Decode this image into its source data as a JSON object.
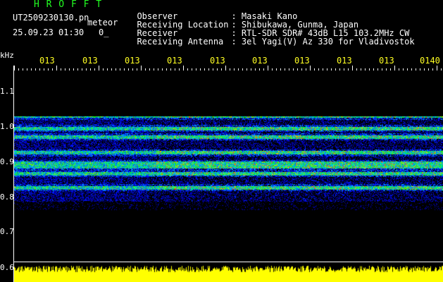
{
  "header": {
    "brand": "H R O F F T",
    "filename": "UT2509230130.pn",
    "mode": "meteor",
    "datetime": "25.09.23 01:30",
    "counter": "0_"
  },
  "info": [
    {
      "label": "Observer",
      "value": ": Masaki Kano"
    },
    {
      "label": "Receiving Location",
      "value": ": Shibukawa, Gunma, Japan"
    },
    {
      "label": "Receiver",
      "value": ": RTL-SDR SDR# 43dB L15 103.2MHz CW"
    },
    {
      "label": "Receiving Antenna",
      "value": ": 3el Yagi(V) Az 330 for Vladivostok"
    }
  ],
  "spectrogram": {
    "unit": "kHz",
    "y_ticks": [
      "1.1",
      "1.0",
      "0.9",
      "0.8",
      "0.7",
      "0.6"
    ],
    "x_ticks": [
      "013",
      "013",
      "013",
      "013",
      "013",
      "013",
      "013",
      "013",
      "013",
      "0140"
    ],
    "freq_range_khz": [
      0.6,
      1.15
    ],
    "signal_band_khz": [
      0.775,
      1.02
    ],
    "lines_khz": [
      1.02,
      0.985,
      0.96,
      0.915,
      0.885,
      0.875,
      0.855,
      0.815
    ],
    "colors": {
      "background": "#000000",
      "text": "#ffffff",
      "brand": "#22ff22",
      "ticks": "#ffff22",
      "power": "#ffff00"
    }
  }
}
